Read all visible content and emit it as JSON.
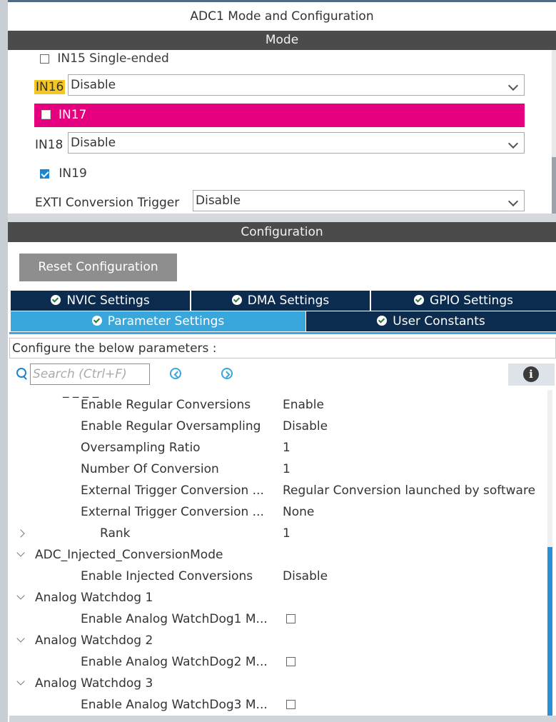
{
  "window": {
    "title": "ADC1 Mode and Configuration"
  },
  "mode": {
    "header": "Mode",
    "in15_label": "IN15 Single-ended",
    "in16_label": "IN16",
    "in16_value": "Disable",
    "in17_label": "IN17",
    "in18_label": "IN18",
    "in18_value": "Disable",
    "in19_label": "IN19",
    "exti_label": "EXTI Conversion Trigger",
    "exti_value": "Disable",
    "highlight_color": "#f6c624",
    "warning_color": "#e4007f"
  },
  "configuration": {
    "header": "Configuration",
    "reset_label": "Reset Configuration",
    "tabs": [
      {
        "label": "NVIC Settings"
      },
      {
        "label": "DMA Settings"
      },
      {
        "label": "GPIO Settings"
      },
      {
        "label": "Parameter Settings"
      },
      {
        "label": "User Constants"
      }
    ],
    "description": "Configure the below parameters :",
    "search_placeholder": "Search (Ctrl+F)",
    "params": [
      {
        "name": "Enable Regular Conversions",
        "value": "Enable"
      },
      {
        "name": "Enable Regular Oversampling",
        "value": "Disable"
      },
      {
        "name": "Oversampling Ratio",
        "value": "1"
      },
      {
        "name": "Number Of Conversion",
        "value": "1"
      },
      {
        "name": "External Trigger Conversion ...",
        "value": "Regular Conversion launched by software"
      },
      {
        "name": "External Trigger Conversion ...",
        "value": "None"
      },
      {
        "name": "Rank",
        "value": "1"
      },
      {
        "name": "ADC_Injected_ConversionMode"
      },
      {
        "name": "Enable Injected Conversions",
        "value": "Disable"
      },
      {
        "name": "Analog Watchdog 1"
      },
      {
        "name": "Enable Analog WatchDog1 M..."
      },
      {
        "name": "Analog Watchdog 2"
      },
      {
        "name": "Enable Analog WatchDog2 M..."
      },
      {
        "name": "Analog Watchdog 3"
      },
      {
        "name": "Enable Analog WatchDog3 M..."
      }
    ],
    "accent_color": "#3aa7dc",
    "tab_dark_color": "#0b2b4f"
  }
}
